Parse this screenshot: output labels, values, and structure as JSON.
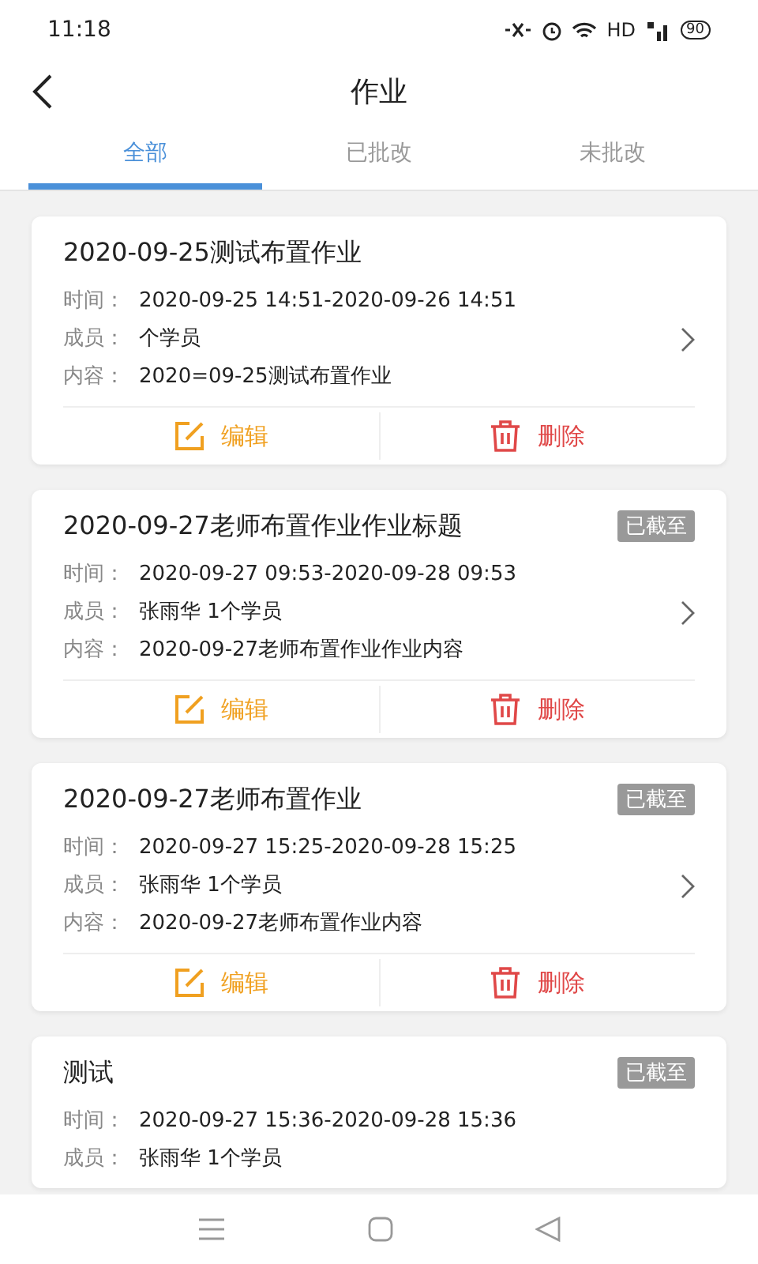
{
  "status_bar": {
    "time": "11:18",
    "network": "HD",
    "battery": "90"
  },
  "header": {
    "title": "作业"
  },
  "tabs": [
    {
      "label": "全部",
      "selected": true
    },
    {
      "label": "已批改",
      "selected": false
    },
    {
      "label": "未批改",
      "selected": false
    }
  ],
  "assignments": [
    {
      "title": "2020-09-25测试布置作业",
      "expired": false,
      "fields": [
        {
          "label": "时间：",
          "value": "2020-09-25 14:51-2020-09-26 14:51"
        },
        {
          "label": "成员：",
          "value": "个学员"
        },
        {
          "label": "内容：",
          "value": "2020=09-25测试布置作业"
        }
      ],
      "edit": "编辑",
      "delete": "删除"
    },
    {
      "title": "2020-09-27老师布置作业作业标题",
      "expired": true,
      "badge": "已截至",
      "fields": [
        {
          "label": "时间：",
          "value": "2020-09-27 09:53-2020-09-28 09:53"
        },
        {
          "label": "成员：",
          "value": "张雨华 1个学员"
        },
        {
          "label": "内容：",
          "value": "2020-09-27老师布置作业作业内容"
        }
      ],
      "edit": "编辑",
      "delete": "删除"
    },
    {
      "title": "2020-09-27老师布置作业",
      "expired": true,
      "badge": "已截至",
      "fields": [
        {
          "label": "时间：",
          "value": "2020-09-27 15:25-2020-09-28 15:25"
        },
        {
          "label": "成员：",
          "value": "张雨华 1个学员"
        },
        {
          "label": "内容：",
          "value": "2020-09-27老师布置作业内容"
        }
      ],
      "edit": "编辑",
      "delete": "删除"
    },
    {
      "title": "测试",
      "expired": true,
      "badge": "已截至",
      "fields": [
        {
          "label": "时间：",
          "value": "2020-09-27 15:36-2020-09-28 15:36"
        },
        {
          "label": "成员：",
          "value": "张雨华 1个学员"
        }
      ]
    }
  ]
}
